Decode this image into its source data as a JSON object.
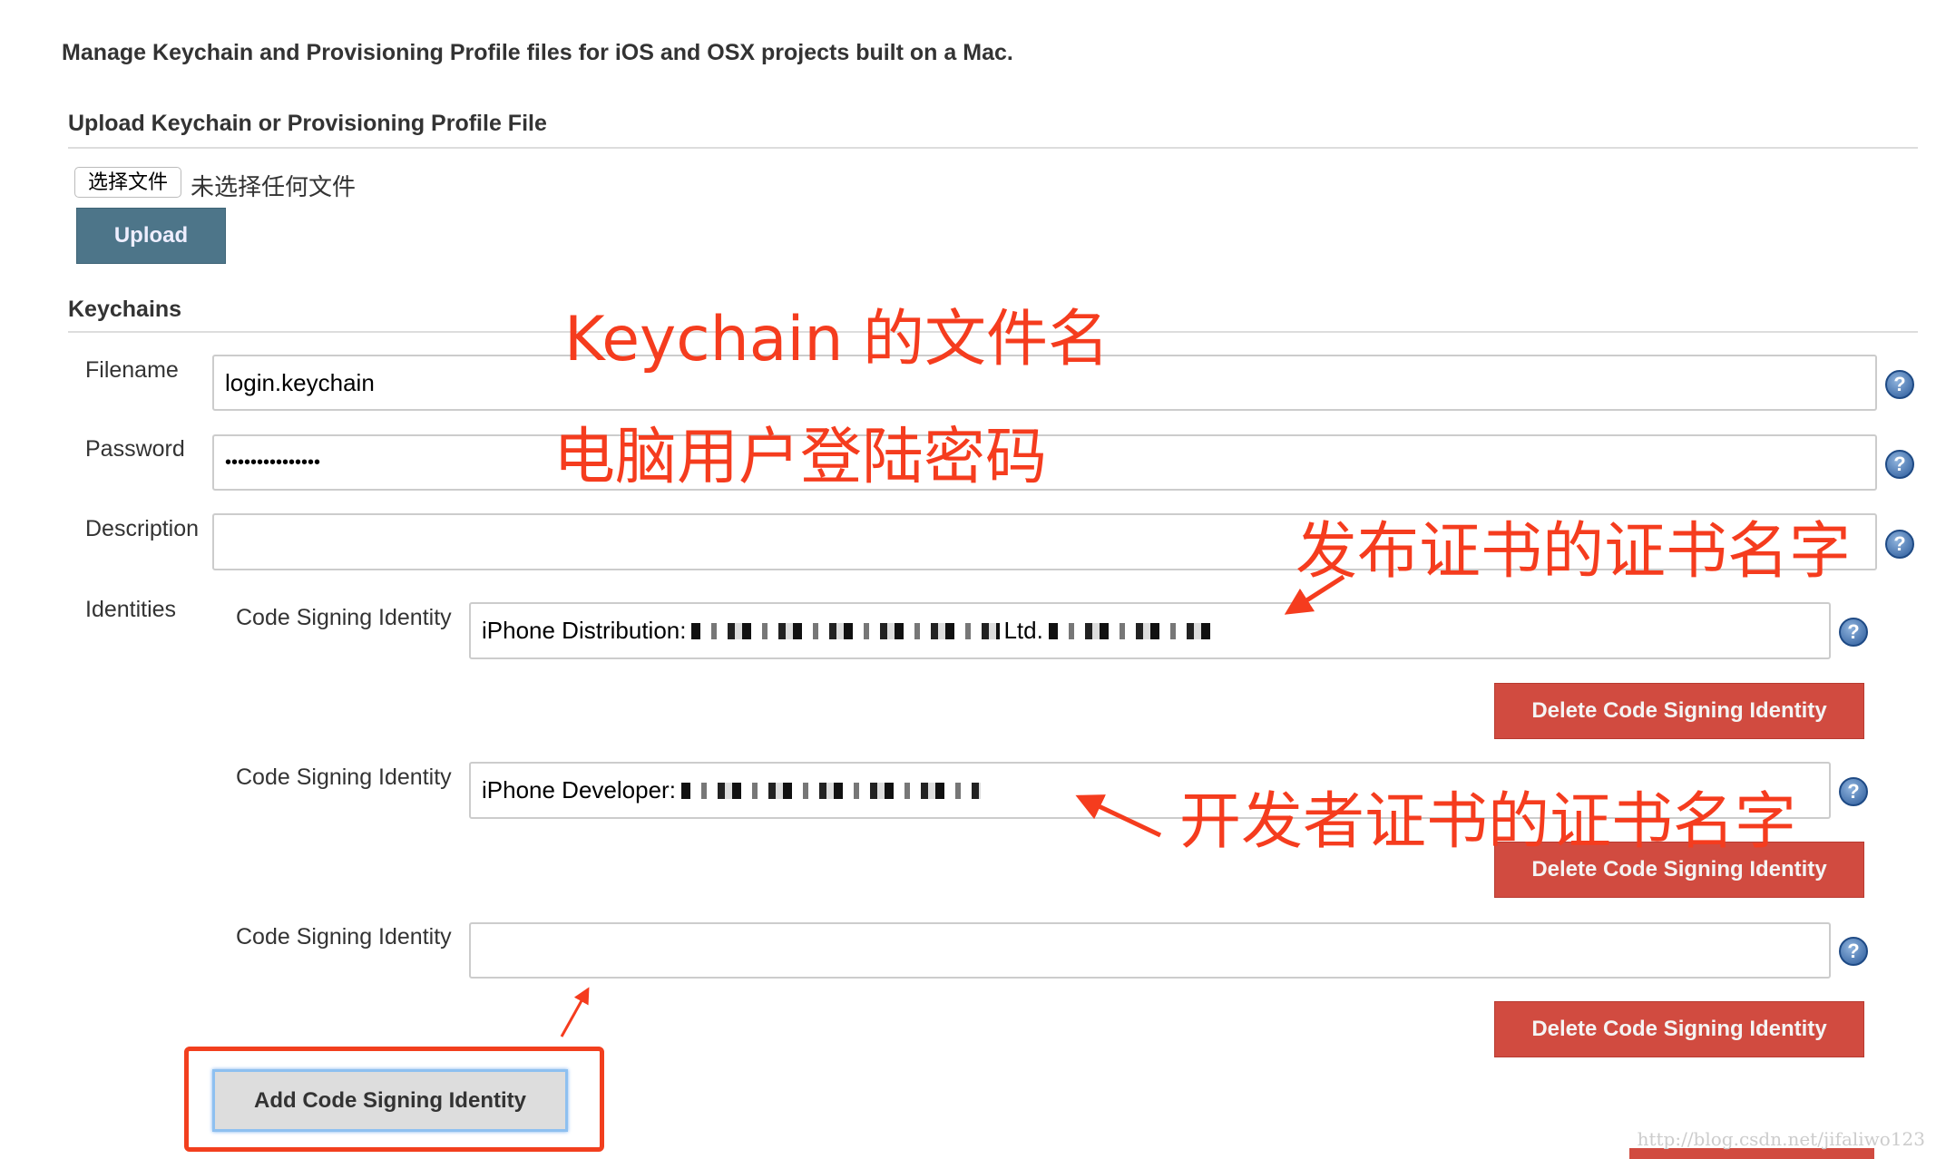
{
  "intro": "Manage Keychain and Provisioning Profile files for iOS and OSX projects built on a Mac.",
  "upload_section": {
    "title": "Upload Keychain or Provisioning Profile File",
    "choose_file": "选择文件",
    "no_file": "未选择任何文件",
    "upload_label": "Upload"
  },
  "keychains": {
    "title": "Keychains",
    "filename_label": "Filename",
    "filename_value": "login.keychain",
    "password_label": "Password",
    "password_value": "•••••••••••••••",
    "description_label": "Description",
    "description_value": "",
    "identities_label": "Identities",
    "identities": [
      {
        "label": "Code Signing Identity",
        "value": "iPhone Distribution:",
        "tail": "Ltd.",
        "delete_label": "Delete Code Signing Identity"
      },
      {
        "label": "Code Signing Identity",
        "value": "iPhone Developer:",
        "tail": "",
        "delete_label": "Delete Code Signing Identity"
      },
      {
        "label": "Code Signing Identity",
        "value": "",
        "tail": "",
        "delete_label": "Delete Code Signing Identity"
      }
    ],
    "add_label": "Add Code Signing Identity"
  },
  "help_icon": "question-circle-icon",
  "annotations": {
    "filename": "Keychain 的文件名",
    "password": "电脑用户登陆密码",
    "distribution": "发布证书的证书名字",
    "developer": "开发者证书的证书名字",
    "color": "#f53c1e"
  },
  "watermark": "http://blog.csdn.net/jifaliwo123"
}
